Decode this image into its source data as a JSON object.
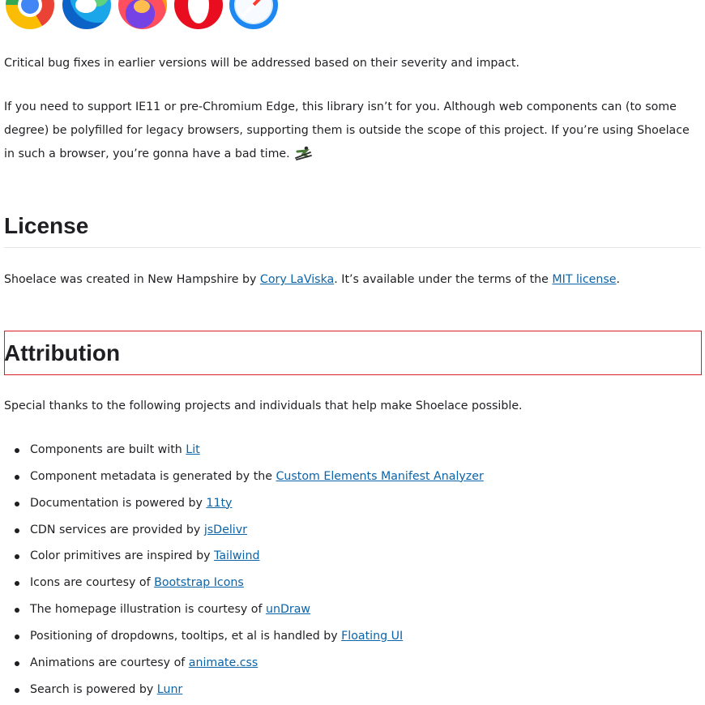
{
  "intro": {
    "browser_icons": [
      "chrome-icon",
      "edge-icon",
      "firefox-icon",
      "opera-icon",
      "safari-icon"
    ],
    "critical_fixes": "Critical bug fixes in earlier versions will be addressed based on their severity and impact.",
    "ie_support": "If you need to support IE11 or pre-Chromium Edge, this library isn’t for you. Although web components can (to some degree) be polyfilled for legacy browsers, supporting them is outside the scope of this project. If you’re using Shoelace in such a browser, you’re gonna have a bad time.",
    "emoji": "skier-icon"
  },
  "license": {
    "heading": "License",
    "text_before": "Shoelace was created in New Hampshire by ",
    "author_link": "Cory LaViska",
    "text_middle": ". It’s available under the terms of the ",
    "license_link": "MIT license",
    "text_after": "."
  },
  "attribution": {
    "heading": "Attribution",
    "intro": "Special thanks to the following projects and individuals that help make Shoelace possible.",
    "items": [
      {
        "text": "Components are built with ",
        "link": "Lit"
      },
      {
        "text": "Component metadata is generated by the ",
        "link": "Custom Elements Manifest Analyzer"
      },
      {
        "text": "Documentation is powered by ",
        "link": "11ty"
      },
      {
        "text": "CDN services are provided by ",
        "link": "jsDelivr"
      },
      {
        "text": "Color primitives are inspired by ",
        "link": "Tailwind"
      },
      {
        "text": "Icons are courtesy of ",
        "link": "Bootstrap Icons"
      },
      {
        "text": "The homepage illustration is courtesy of ",
        "link": "unDraw"
      },
      {
        "text": "Positioning of dropdowns, tooltips, et al is handled by ",
        "link": "Floating UI"
      },
      {
        "text": "Animations are courtesy of ",
        "link": "animate.css"
      },
      {
        "text": "Search is powered by ",
        "link": "Lunr"
      }
    ]
  },
  "colors": {
    "link": "#0b63a8",
    "highlight_border": "#d71f2a",
    "text": "#1f1f23"
  }
}
